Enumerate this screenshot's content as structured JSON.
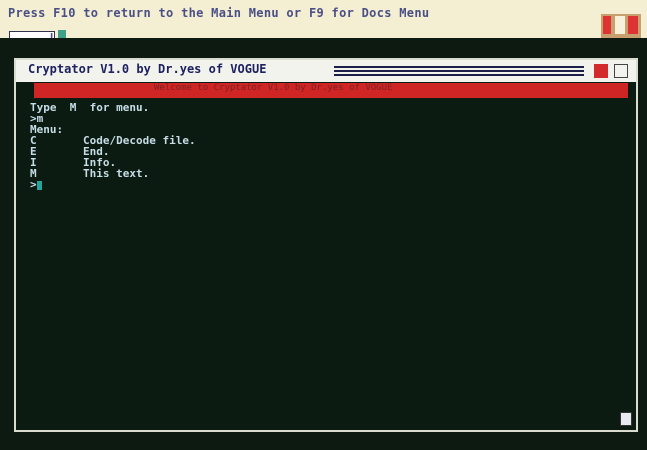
{
  "top_message": "Press F10 to return to the Main Menu or F9 for Docs Menu",
  "prompt": {
    "value": "",
    "marker": "!"
  },
  "window": {
    "title": "Cryptator V1.0  by Dr.yes of VOGUE",
    "banner": "Welcome to Cryptator V1.0 by Dr.yes of VOGUE"
  },
  "console": {
    "lines": [
      "Type  M  for menu.",
      ">m",
      "Menu:",
      "C       Code/Decode file.",
      "E       End.",
      "I       Info.",
      "M       This text.",
      ">"
    ]
  },
  "colors": {
    "banner": "#d02525",
    "text": "#c7dde6",
    "cursor": "#24a59b",
    "title_text": "#1d2160"
  }
}
